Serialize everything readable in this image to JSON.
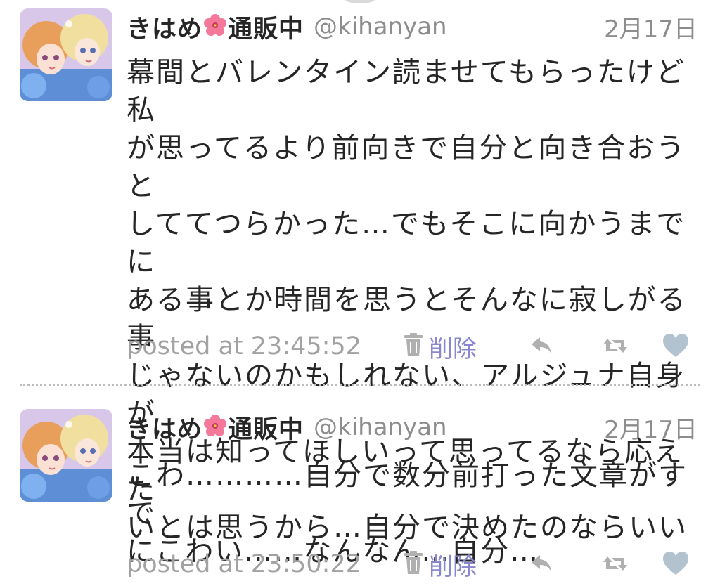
{
  "tweets": [
    {
      "display_name": "きはめ",
      "display_name_suffix": "通販中",
      "handle": "@kihanyan",
      "date": "2月17日",
      "lines": [
        "幕間とバレンタイン読ませてもらったけど私",
        "が思ってるより前向きで自分と向き合おうと",
        "しててつらかった…でもそこに向かうまでに",
        "ある事とか時間を思うとそんなに寂しがる事",
        "じゃないのかもしれない、アルジュナ自身が",
        "本当は知ってほしいって思ってるなら応えた",
        "いとは思うから…自分で決めたのならいい"
      ],
      "posted_at": "posted at 23:45:52",
      "delete_label": "削除"
    },
    {
      "display_name": "きはめ",
      "display_name_suffix": "通販中",
      "handle": "@kihanyan",
      "date": "2月17日",
      "lines": [
        "こわ…………自分で数分前打った文章がすで",
        "にこわい……なんなん…自分…"
      ],
      "posted_at": "posted at 23:50:22",
      "delete_label": "削除"
    }
  ],
  "icons": {
    "name_emoji": "hibiscus-icon",
    "delete": "trash-icon",
    "reply": "reply-icon",
    "retweet": "retweet-icon",
    "like": "heart-icon"
  },
  "colors": {
    "delete_link": "#8a86cf",
    "meta_gray": "#8d8d8d",
    "icon_gray": "#b0b0b0",
    "heart": "#b3c2cf",
    "hibiscus": "#f3789a"
  }
}
